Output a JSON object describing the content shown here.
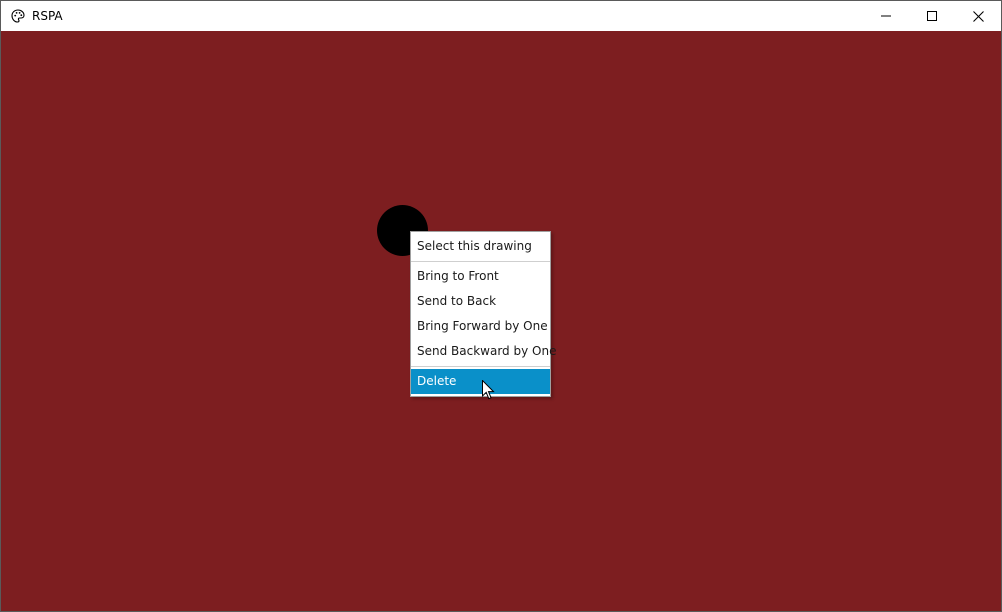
{
  "window": {
    "title": "RSPA",
    "background_color": "#7d1e20"
  },
  "titlebar": {
    "icons": [
      "palette-icon"
    ],
    "buttons": [
      "minimize-icon",
      "maximize-icon",
      "close-icon"
    ]
  },
  "canvas": {
    "shape": {
      "type": "circle",
      "color": "#000000"
    }
  },
  "context_menu": {
    "items": [
      {
        "label": "Select this drawing"
      },
      {
        "label": "Bring to Front"
      },
      {
        "label": "Send to Back"
      },
      {
        "label": "Bring Forward by One"
      },
      {
        "label": "Send Backward by One"
      },
      {
        "label": "Delete",
        "highlighted": true
      }
    ],
    "highlight_color": "#0a90c9"
  }
}
